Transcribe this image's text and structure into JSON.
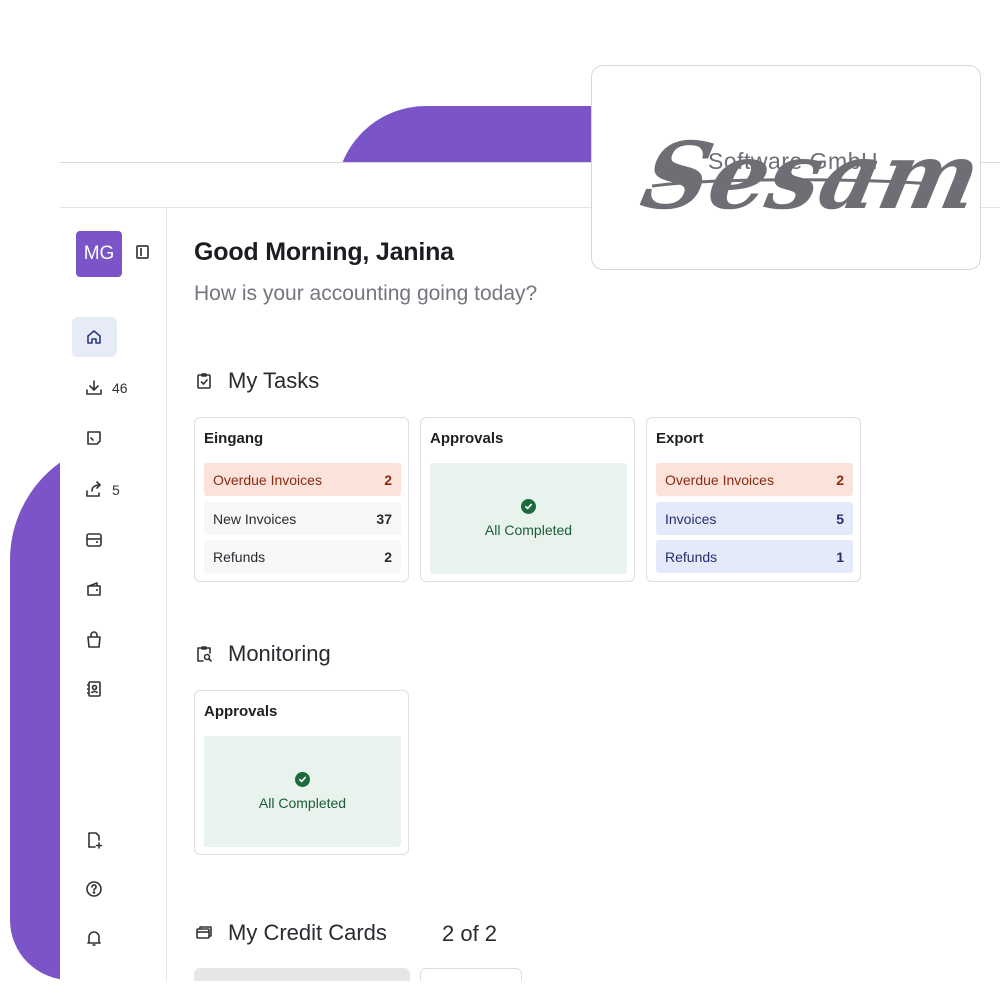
{
  "brand": {
    "company_name": "Software GmbH",
    "logo_word": "Sesam",
    "accent": "#7b55c8"
  },
  "sidebar": {
    "avatar_initials": "MG",
    "items": [
      {
        "icon": "home-icon",
        "count": ""
      },
      {
        "icon": "inbox-download-icon",
        "count": "46"
      },
      {
        "icon": "approval-icon",
        "count": ""
      },
      {
        "icon": "export-icon",
        "count": "5"
      },
      {
        "icon": "wallet-icon",
        "count": ""
      },
      {
        "icon": "purse-icon",
        "count": ""
      },
      {
        "icon": "shopping-bag-icon",
        "count": ""
      },
      {
        "icon": "contacts-icon",
        "count": ""
      },
      {
        "icon": "add-document-icon",
        "count": ""
      },
      {
        "icon": "help-icon",
        "count": ""
      },
      {
        "icon": "bell-icon",
        "count": ""
      }
    ]
  },
  "header": {
    "greeting": "Good Morning, Janina",
    "subgreeting": "How is your accounting going today?"
  },
  "tasks": {
    "title": "My Tasks",
    "cards": [
      {
        "title": "Eingang",
        "rows": [
          {
            "label": "Overdue Invoices",
            "count": "2"
          },
          {
            "label": "New Invoices",
            "count": "37"
          },
          {
            "label": "Refunds",
            "count": "2"
          }
        ]
      },
      {
        "title": "Approvals",
        "status": "All Completed"
      },
      {
        "title": "Export",
        "rows": [
          {
            "label": "Overdue Invoices",
            "count": "2"
          },
          {
            "label": "Invoices",
            "count": "5"
          },
          {
            "label": "Refunds",
            "count": "1"
          }
        ]
      }
    ]
  },
  "monitoring": {
    "title": "Monitoring",
    "cards": [
      {
        "title": "Approvals",
        "status": "All Completed"
      }
    ]
  },
  "credit_cards": {
    "title": "My Credit Cards",
    "pager": "2 of 2"
  }
}
